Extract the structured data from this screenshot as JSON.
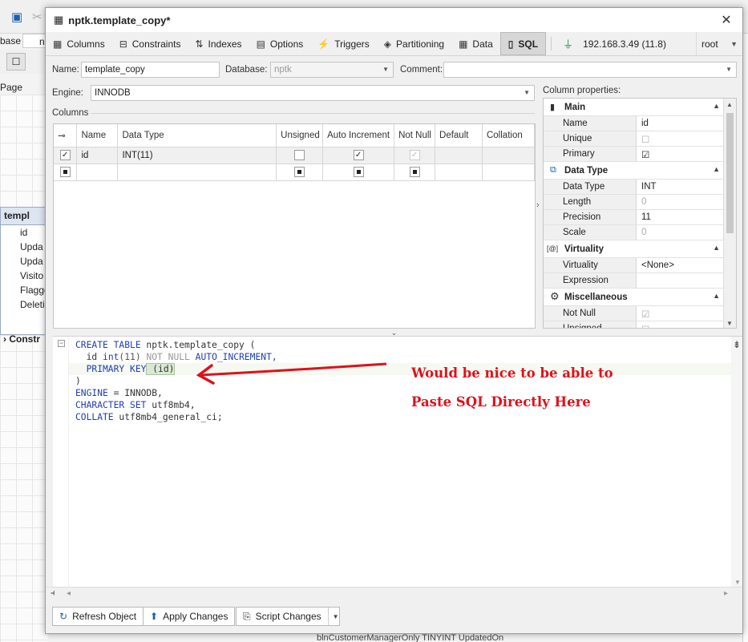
{
  "background": {
    "toolbar_label": "base",
    "partial_field": "n",
    "page_label": "Page",
    "entity_title": "templ",
    "entity_rows": [
      "id",
      "Upda",
      "Upda",
      "Visito",
      "Flagge",
      "Deleti",
      "Deleti"
    ],
    "constraints_label": "Constr",
    "bottom_text": "blnCustomerManagerOnly    TINYINT                                       UpdatedOn"
  },
  "dialog": {
    "title": "nptk.template_copy*",
    "close_glyph": "✕"
  },
  "tabs": [
    {
      "label": "Columns",
      "icon": "▦"
    },
    {
      "label": "Constraints",
      "icon": "⊟"
    },
    {
      "label": "Indexes",
      "icon": "⇅"
    },
    {
      "label": "Options",
      "icon": "▤"
    },
    {
      "label": "Triggers",
      "icon": "⚡"
    },
    {
      "label": "Partitioning",
      "icon": "◈"
    },
    {
      "label": "Data",
      "icon": "▦"
    },
    {
      "label": "SQL",
      "icon": "▯"
    }
  ],
  "connection": {
    "host": "192.168.3.49 (11.8)",
    "user": "root"
  },
  "form": {
    "name_label": "Name:",
    "name_value": "template_copy",
    "database_label": "Database:",
    "database_value": "nptk",
    "comment_label": "Comment:",
    "comment_value": "",
    "engine_label": "Engine:",
    "engine_value": "INNODB",
    "columns_label": "Columns",
    "column_properties_label": "Column properties:"
  },
  "grid": {
    "headers": [
      "",
      "Name",
      "Data Type",
      "Unsigned",
      "Auto Increment",
      "Not Null",
      "Default",
      "Collation"
    ],
    "row1": {
      "name": "id",
      "type": "INT(11)",
      "default": "",
      "collation": ""
    }
  },
  "props": {
    "groups": [
      {
        "title": "Main",
        "icon": "▮",
        "rows": [
          {
            "k": "Name",
            "v": "id"
          },
          {
            "k": "Unique",
            "v": "☐"
          },
          {
            "k": "Primary",
            "v": "☑"
          }
        ]
      },
      {
        "title": "Data Type",
        "icon": "⧉",
        "rows": [
          {
            "k": "Data Type",
            "v": "INT"
          },
          {
            "k": "Length",
            "v": "0"
          },
          {
            "k": "Precision",
            "v": "11"
          },
          {
            "k": "Scale",
            "v": "0"
          }
        ]
      },
      {
        "title": "Virtuality",
        "icon": "[@]",
        "rows": [
          {
            "k": "Virtuality",
            "v": "<None>"
          },
          {
            "k": "Expression",
            "v": ""
          }
        ]
      },
      {
        "title": "Miscellaneous",
        "icon": "⚙",
        "rows": [
          {
            "k": "Not Null",
            "v": "☑"
          },
          {
            "k": "Unsigned",
            "v": "☐"
          }
        ]
      }
    ]
  },
  "sql": {
    "line1_a": "CREATE TABLE",
    "line1_b": " nptk.template_copy (",
    "line2_a": "  id ",
    "line2_b": "int",
    "line2_c": "(11)",
    "line2_d": " NOT NULL",
    "line2_e": " AUTO_INCREMENT,",
    "line3_a": "  PRIMARY KEY",
    "line3_b": " (id)",
    "line4": ")",
    "line5_a": "ENGINE",
    "line5_b": " = INNODB,",
    "line6_a": "CHARACTER SET",
    "line6_b": " utf8mb4,",
    "line7_a": "COLLATE",
    "line7_b": " utf8mb4_general_ci;"
  },
  "annotation": {
    "line1": "Would be nice to be able to",
    "line2": "Paste SQL Directly Here",
    "color": "#e0101a"
  },
  "footer": {
    "refresh": "Refresh Object",
    "apply": "Apply Changes",
    "script": "Script Changes"
  }
}
